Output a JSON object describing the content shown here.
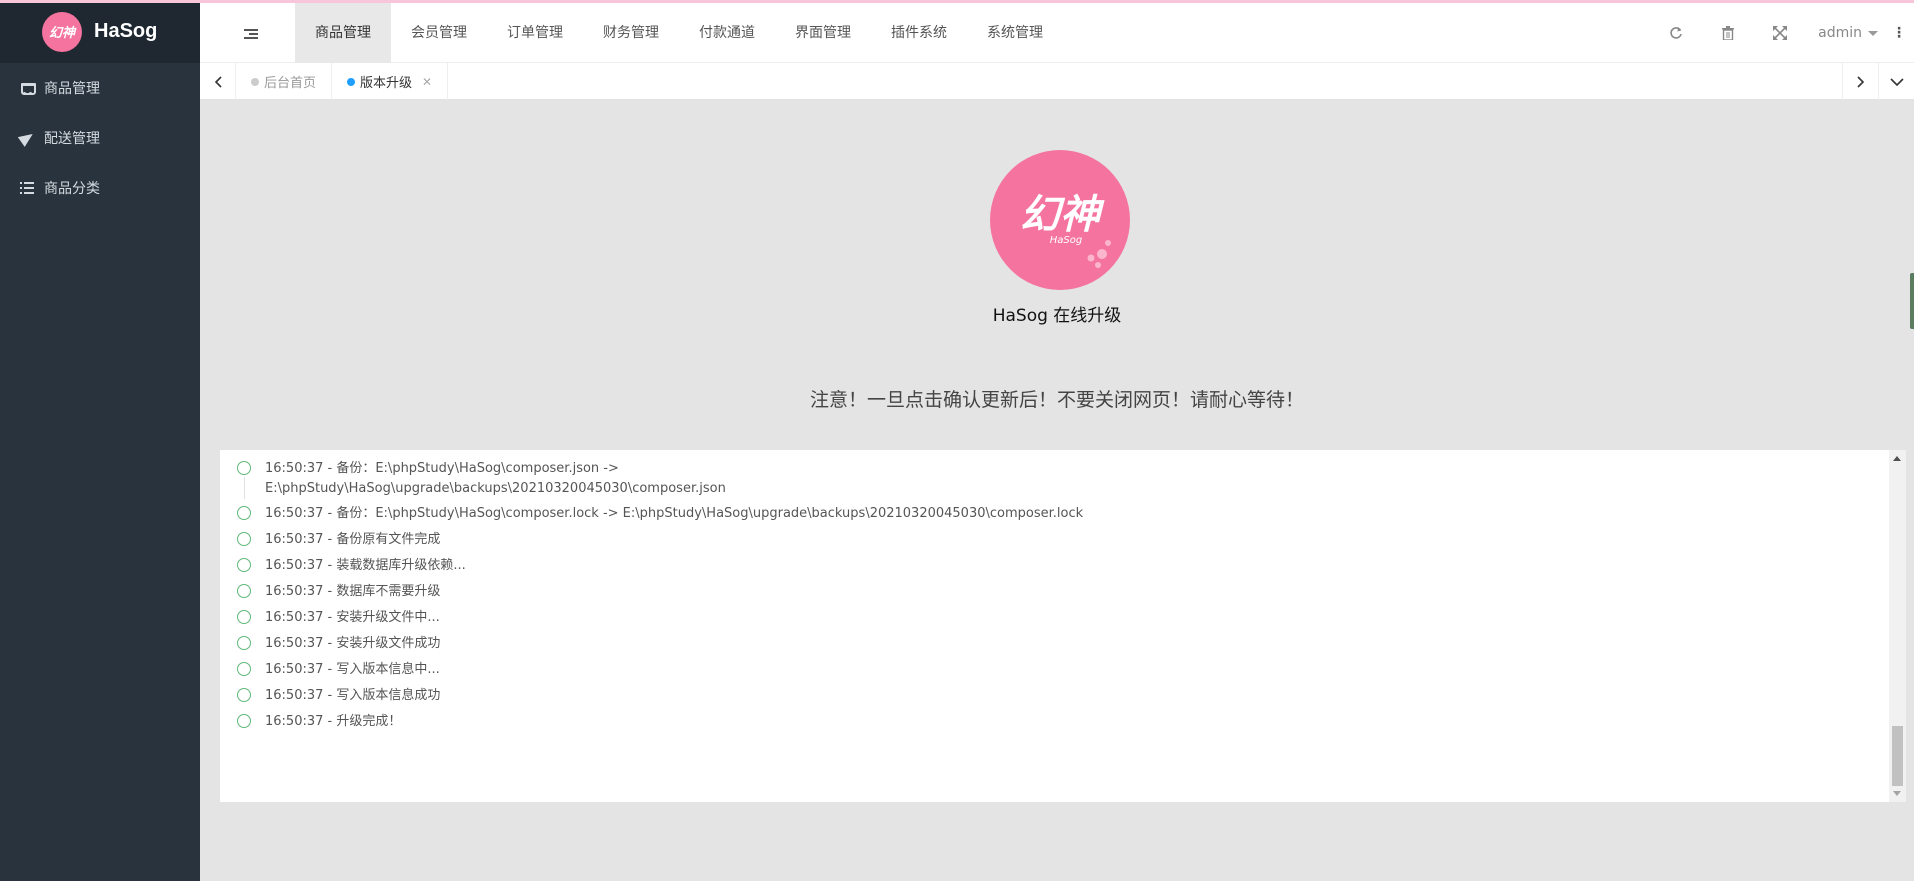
{
  "brand": {
    "logo_text": "HaSog",
    "logo_mark": "幻神"
  },
  "sidebar": {
    "items": [
      {
        "label": "商品管理",
        "icon": "cart-icon"
      },
      {
        "label": "配送管理",
        "icon": "paper-plane-icon"
      },
      {
        "label": "商品分类",
        "icon": "list-icon"
      }
    ]
  },
  "topnav": {
    "items": [
      {
        "label": "商品管理",
        "active": true
      },
      {
        "label": "会员管理"
      },
      {
        "label": "订单管理"
      },
      {
        "label": "财务管理"
      },
      {
        "label": "付款通道"
      },
      {
        "label": "界面管理"
      },
      {
        "label": "插件系统"
      },
      {
        "label": "系统管理"
      }
    ]
  },
  "header": {
    "user": "admin",
    "icons": [
      "refresh-icon",
      "trash-icon",
      "fullscreen-icon",
      "more-vertical-icon"
    ]
  },
  "tabs": {
    "items": [
      {
        "label": "后台首页",
        "active": false
      },
      {
        "label": "版本升级",
        "active": true,
        "closable": true
      }
    ]
  },
  "main": {
    "logo_mark": "幻神",
    "logo_subtext": "HaSog",
    "title": "HaSog 在线升级",
    "notice": "注意！一旦点击确认更新后！不要关闭网页！请耐心等待！"
  },
  "log": {
    "entries": [
      "16:50:37 - 备份：E:\\phpStudy\\HaSog\\composer.json -> E:\\phpStudy\\HaSog\\upgrade\\backups\\20210320045030\\composer.json",
      "16:50:37 - 备份：E:\\phpStudy\\HaSog\\composer.lock -> E:\\phpStudy\\HaSog\\upgrade\\backups\\20210320045030\\composer.lock",
      "16:50:37 - 备份原有文件完成",
      "16:50:37 - 装载数据库升级依赖...",
      "16:50:37 - 数据库不需要升级",
      "16:50:37 - 安装升级文件中...",
      "16:50:37 - 安装升级文件成功",
      "16:50:37 - 写入版本信息中...",
      "16:50:37 - 写入版本信息成功",
      "16:50:37 - 升级完成！"
    ],
    "scroll_position": 0.95
  },
  "colors": {
    "brand_pink": "#f4739f",
    "sidebar_bg": "#28333e",
    "timeline_green": "#5fb878",
    "active_tab_dot": "#1e9fff"
  }
}
